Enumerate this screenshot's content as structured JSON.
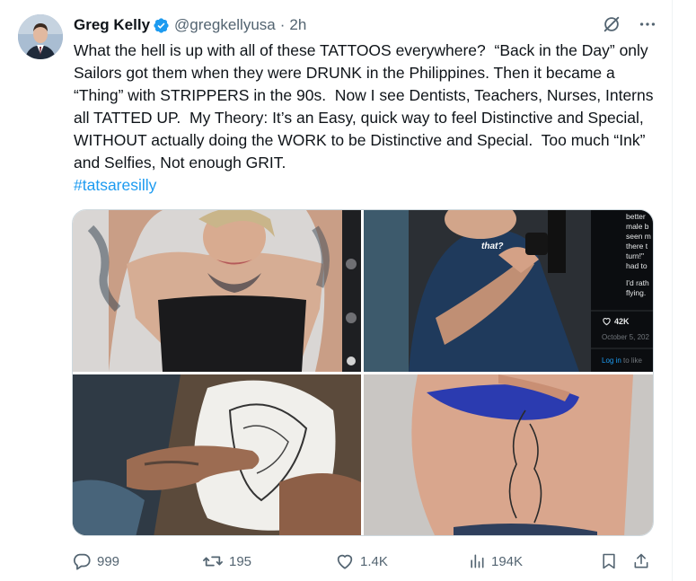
{
  "author": {
    "name": "Greg Kelly",
    "handle": "@gregkellyusa",
    "separator": "·",
    "time": "2h"
  },
  "tweet": {
    "text": "What the hell is up with all of these TATTOOS everywhere?  “Back in the Day” only Sailors got them when they were DRUNK in the Philippines. Then it became a “Thing” with STRIPPERS in the 90s.  Now I see Dentists, Teachers, Nurses, Interns all TATTED UP.  My Theory: It’s an Easy, quick way to feel Distinctive and Special, WITHOUT actually doing the WORK to be Distinctive and Special.  Too much “Ink” and Selfies, Not enough GRIT.",
    "hashtag": "#tatsaresilly"
  },
  "media": {
    "image2_overlay": {
      "caption": "that?",
      "side_text": [
        "better",
        "male b",
        "seen m",
        "there t",
        "turn!\"",
        "had to",
        "I'd rath",
        "flying."
      ],
      "likes": "42K",
      "date": "October 5, 202",
      "login": "Log in",
      "login_tail": "to like"
    }
  },
  "actions": {
    "replies": "999",
    "reposts": "195",
    "likes": "1.4K",
    "views": "194K"
  },
  "icons": {
    "verified": "verified-badge-icon",
    "grok": "grok-icon",
    "more": "more-icon",
    "reply": "reply-icon",
    "repost": "repost-icon",
    "like": "like-icon",
    "views": "views-icon",
    "bookmark": "bookmark-icon",
    "share": "share-icon"
  },
  "colors": {
    "text": "#0f1419",
    "secondary": "#536471",
    "link": "#1d9bf0",
    "verified": "#1d9bf0"
  }
}
